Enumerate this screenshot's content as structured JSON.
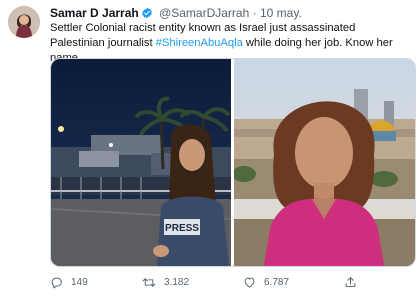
{
  "user": {
    "name": "Samar D Jarrah",
    "handle": "@SamarDJarrah",
    "separator": "·",
    "date": "10 may."
  },
  "tweet": {
    "text_before": "Settler Colonial racist entity known as Israel just assassinated Palestinian journalist ",
    "hashtag": "#ShireenAbuAqla",
    "text_after": " while doing her job. Know her name."
  },
  "media": {
    "press_vest_text": "PRESS"
  },
  "actions": {
    "replies": "149",
    "retweets": "3.182",
    "likes": "6.787"
  },
  "icons": {
    "verified": "verified-badge-icon",
    "reply": "reply-icon",
    "retweet": "retweet-icon",
    "like": "heart-icon",
    "share": "share-icon"
  },
  "colors": {
    "hashtag": "#1d9bf0",
    "verified": "#1d9bf0",
    "secondary_text": "#536471"
  }
}
